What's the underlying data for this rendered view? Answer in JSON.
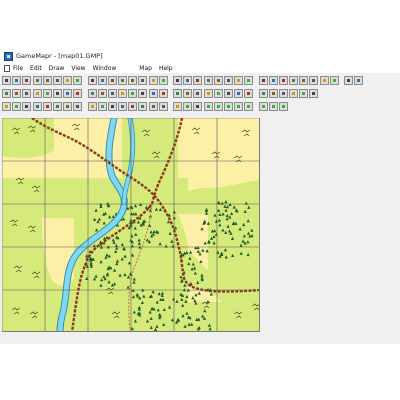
{
  "window": {
    "title": "GameMapr - [map01.GMP]"
  },
  "menu": {
    "items": [
      "File",
      "Edit",
      "Draw",
      "View",
      "Window",
      "Map",
      "Help"
    ]
  },
  "toolbars": [
    {
      "name": "toolbar-standard",
      "icons": [
        "new-icon",
        "open-icon",
        "save-icon",
        "print-icon",
        "cut-icon",
        "copy-icon",
        "paste-icon",
        "undo-icon",
        "redo-icon",
        "grid-icon",
        "zoom-in-icon",
        "zoom-out-icon",
        "select-icon",
        "pan-icon",
        "text-icon",
        "line-icon",
        "rect-icon",
        "fill-icon",
        "hex-icon",
        "square-icon",
        "terrain-icon",
        "layer-icon",
        "palette-icon",
        "lock-icon",
        "unit-icon",
        "flag-icon",
        "road-icon",
        "river-icon",
        "forest-icon",
        "hill-icon",
        "town-icon",
        "bridge-icon",
        "clear-icon",
        "help-icon"
      ]
    },
    {
      "name": "toolbar-draw",
      "icons": [
        "pointer-icon",
        "pencil-icon",
        "eraser-icon",
        "stop-icon",
        "brush-icon",
        "marker-icon",
        "arrow-icon",
        "curve-icon",
        "rotate-icon",
        "mirror-icon",
        "dash-icon",
        "dot-icon",
        "thick-line-icon",
        "thin-line-icon",
        "align-icon",
        "group-icon",
        "ungroup-icon",
        "order-icon",
        "snap-icon",
        "measure-icon",
        "overlay-icon",
        "green-layer-icon",
        "grid-toggle-icon",
        "label-icon",
        "symbol-icon",
        "counter-icon",
        "scale-icon",
        "compass-icon",
        "legend-icon",
        "refresh-icon"
      ]
    },
    {
      "name": "toolbar-terrain",
      "icons": [
        "clear-terrain-icon",
        "rough-icon",
        "swamp-icon",
        "water-icon",
        "sand-icon",
        "road-tool-icon",
        "trail-icon",
        "rail-icon",
        "fence-icon",
        "wall-icon",
        "woods-icon",
        "jungle-icon",
        "brush-terrain-icon",
        "crop-icon",
        "building-icon",
        "ruins-icon",
        "crater-icon",
        "mountain-icon",
        "slope-icon",
        "ridge-icon",
        "stream-icon",
        "ford-icon",
        "tree-icon",
        "grass-icon",
        "pine-icon",
        "shrub-icon",
        "orchard-icon"
      ]
    }
  ],
  "colors": {
    "grass": "#d6ea7c",
    "sand": "#fbf0a5",
    "river": "#7fd8f2",
    "road": "#8a3a1c",
    "forest": "#1f5c27",
    "grid": "#555555",
    "accent_green": "#33b533"
  }
}
